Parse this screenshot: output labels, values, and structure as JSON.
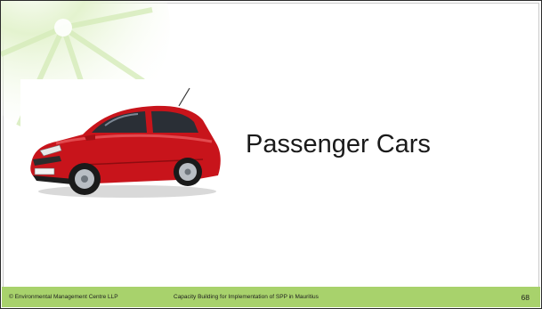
{
  "slide": {
    "title": "Passenger Cars",
    "image": "red-hatchback-car"
  },
  "footer": {
    "organization": "© Environmental Management Centre LLP",
    "subject": "Capacity Building for Implementation of SPP in Mauritius",
    "page_number": "68"
  },
  "colors": {
    "footer_bar": "#a8d26c",
    "car_body": "#c8141b",
    "decor_lime": "#b9e08a"
  }
}
